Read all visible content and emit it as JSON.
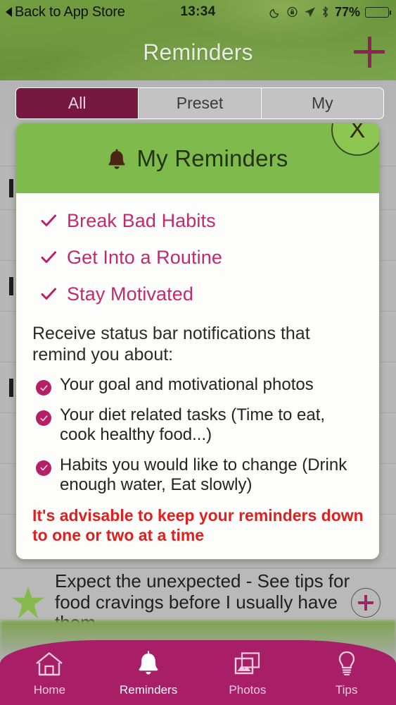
{
  "status_bar": {
    "back_label": "Back to App Store",
    "back_icon": "back-triangle-icon",
    "time": "13:34",
    "battery_percent": "77%",
    "icons": [
      "moon-do-not-disturb-icon",
      "rotation-lock-icon",
      "location-arrow-icon",
      "bluetooth-icon",
      "battery-icon"
    ]
  },
  "nav_bar": {
    "title": "Reminders",
    "add_icon": "plus-icon"
  },
  "segmented_control": {
    "options": [
      {
        "label": "All",
        "selected": true
      },
      {
        "label": "Preset",
        "selected": false
      },
      {
        "label": "My",
        "selected": false
      }
    ],
    "selected_color": "#761840"
  },
  "modal": {
    "header": {
      "icon": "bell-icon",
      "title": "My Reminders",
      "bg_color": "#7fba4c",
      "close_label": "X"
    },
    "checklist": [
      "Break Bad Habits",
      "Get Into a Routine",
      "Stay Motivated"
    ],
    "checklist_color": "#c22a6f",
    "intro": "Receive status bar notifications that remind you about:",
    "bullets": [
      "Your goal and motivational photos",
      "Your diet related tasks (Time to eat, cook healthy food...)",
      "Habits you would like to change (Drink enough water, Eat slowly)"
    ],
    "bullet_color": "#b51f66",
    "warning": "It's advisable to keep your reminders down to one or two at a time",
    "warning_color": "#e01f1f"
  },
  "background_row": {
    "icon": "star-icon",
    "text": "Expect the unexpected - See tips for food cravings before I usually have them",
    "add_icon": "plus-circle-icon"
  },
  "tab_bar": {
    "bg_color": "#a81f68",
    "items": [
      {
        "label": "Home",
        "icon": "home-icon",
        "active": false
      },
      {
        "label": "Reminders",
        "icon": "bell-icon",
        "active": true
      },
      {
        "label": "Photos",
        "icon": "photos-icon",
        "active": false
      },
      {
        "label": "Tips",
        "icon": "lightbulb-icon",
        "active": false
      }
    ]
  }
}
